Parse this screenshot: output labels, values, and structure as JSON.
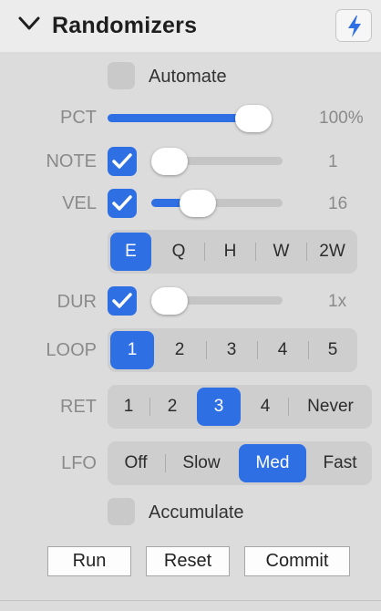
{
  "header": {
    "title": "Randomizers"
  },
  "automate": {
    "label": "Automate",
    "checked": false
  },
  "pct": {
    "label": "PCT",
    "value": "100%",
    "level": 1.0
  },
  "note": {
    "label": "NOTE",
    "checked": true,
    "value": "1",
    "level": 0.0
  },
  "vel": {
    "label": "VEL",
    "checked": true,
    "value": "16",
    "level": 0.3
  },
  "length_options": [
    "E",
    "Q",
    "H",
    "W",
    "2W"
  ],
  "length_selected": "E",
  "dur": {
    "label": "DUR",
    "checked": true,
    "value": "1x",
    "level": 0.0
  },
  "loop": {
    "label": "LOOP",
    "options": [
      "1",
      "2",
      "3",
      "4",
      "5"
    ],
    "selected": "1"
  },
  "ret": {
    "label": "RET",
    "options": [
      "1",
      "2",
      "3",
      "4",
      "Never"
    ],
    "selected": "3"
  },
  "lfo": {
    "label": "LFO",
    "options": [
      "Off",
      "Slow",
      "Med",
      "Fast"
    ],
    "selected": "Med"
  },
  "accumulate": {
    "label": "Accumulate",
    "checked": false
  },
  "buttons": {
    "run": "Run",
    "reset": "Reset",
    "commit": "Commit"
  },
  "colors": {
    "accent": "#2f6fe4",
    "panel": "#dcdcdc",
    "header": "#ececec"
  }
}
